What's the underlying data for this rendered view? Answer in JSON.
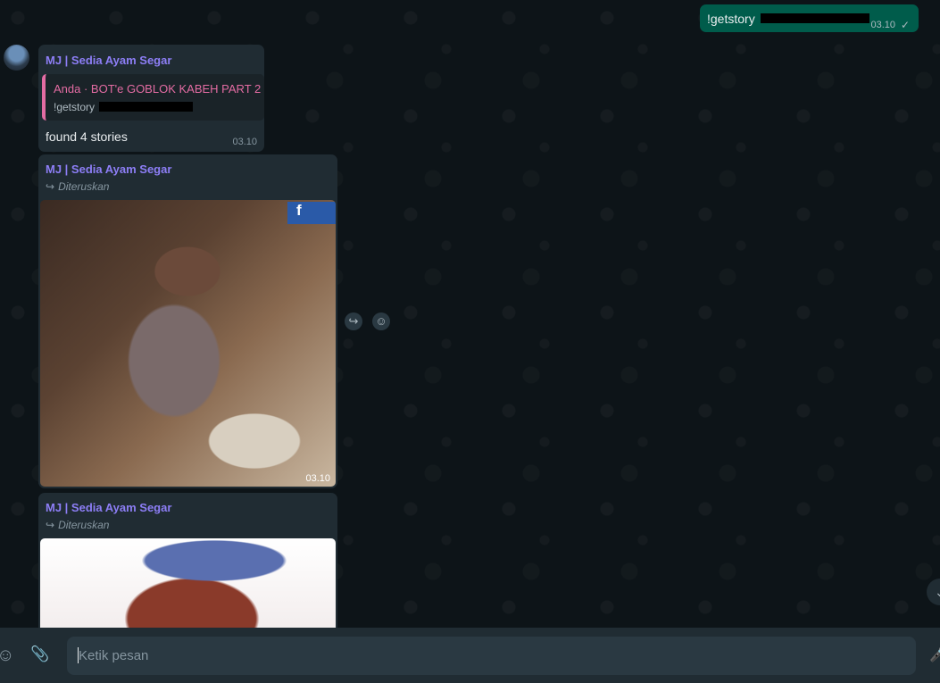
{
  "outgoing": {
    "text": "!getstory",
    "time": "03.10",
    "tick": "✓"
  },
  "incoming": [
    {
      "sender": "MJ | Sedia Ayam Segar",
      "quote_title": "Anda · BOT'e GOBLOK KABEH PART 2",
      "quote_text": "!getstory",
      "body": "found 4 stories",
      "time": "03.10"
    },
    {
      "sender": "MJ | Sedia Ayam Segar",
      "forwarded": "Diteruskan",
      "badge": "f",
      "time": "03.10"
    },
    {
      "sender": "MJ | Sedia Ayam Segar",
      "forwarded": "Diteruskan"
    }
  ],
  "composer": {
    "placeholder": "Ketik pesan"
  },
  "icons": {
    "forward": "↪",
    "emoji": "☺",
    "attach": "📎",
    "mic": "🎤",
    "scroll": "⌄"
  }
}
